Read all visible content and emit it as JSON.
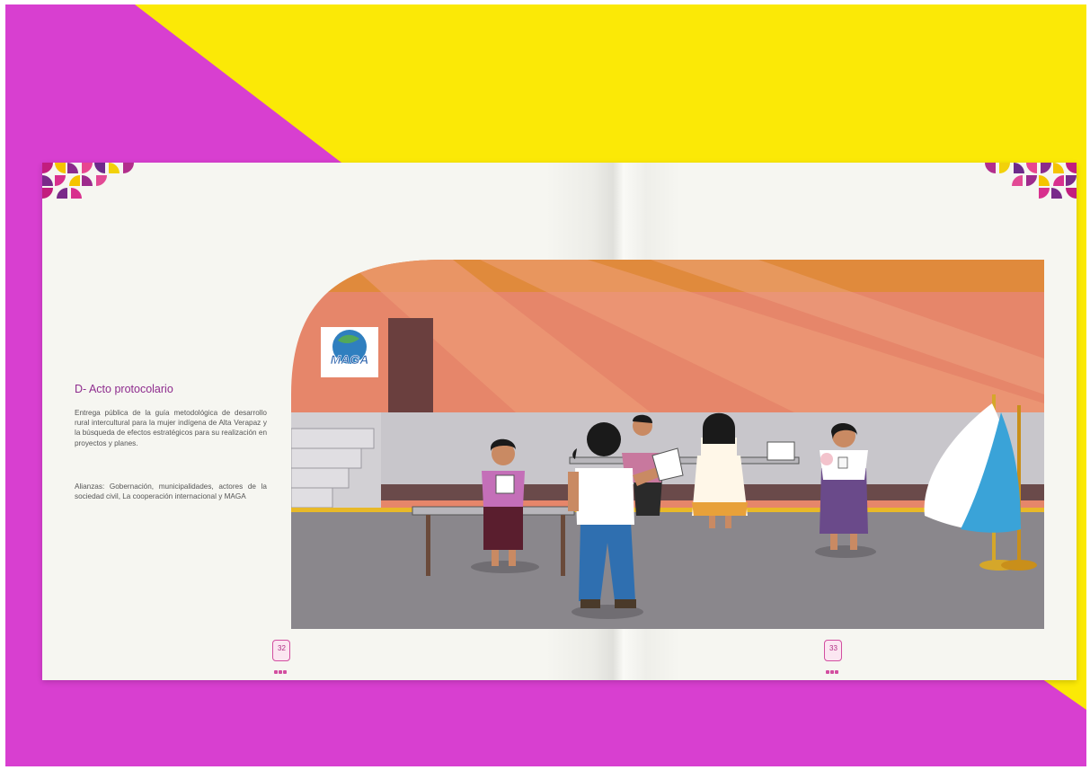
{
  "colors": {
    "background_magenta": "#d83fd0",
    "background_yellow": "#fbe906",
    "page": "#f6f6f1",
    "heading": "#8e2c8e",
    "accent_pink": "#d24ea0"
  },
  "left_page": {
    "heading": "D- Acto protocolario",
    "paragraph_1": "Entrega pública de la guía metodológica de desarrollo rural intercultural para la mujer indígena de Alta Verapaz y la búsqueda de efectos estratégicos para su realización en proyectos y planes.",
    "paragraph_2": "Alianzas: Gobernación, municipalidades, actores de la sociedad civil, La cooperación internacional y MAGA",
    "page_number": "32"
  },
  "right_page": {
    "page_number": "33"
  },
  "illustration": {
    "logo_text": "MAGA"
  }
}
